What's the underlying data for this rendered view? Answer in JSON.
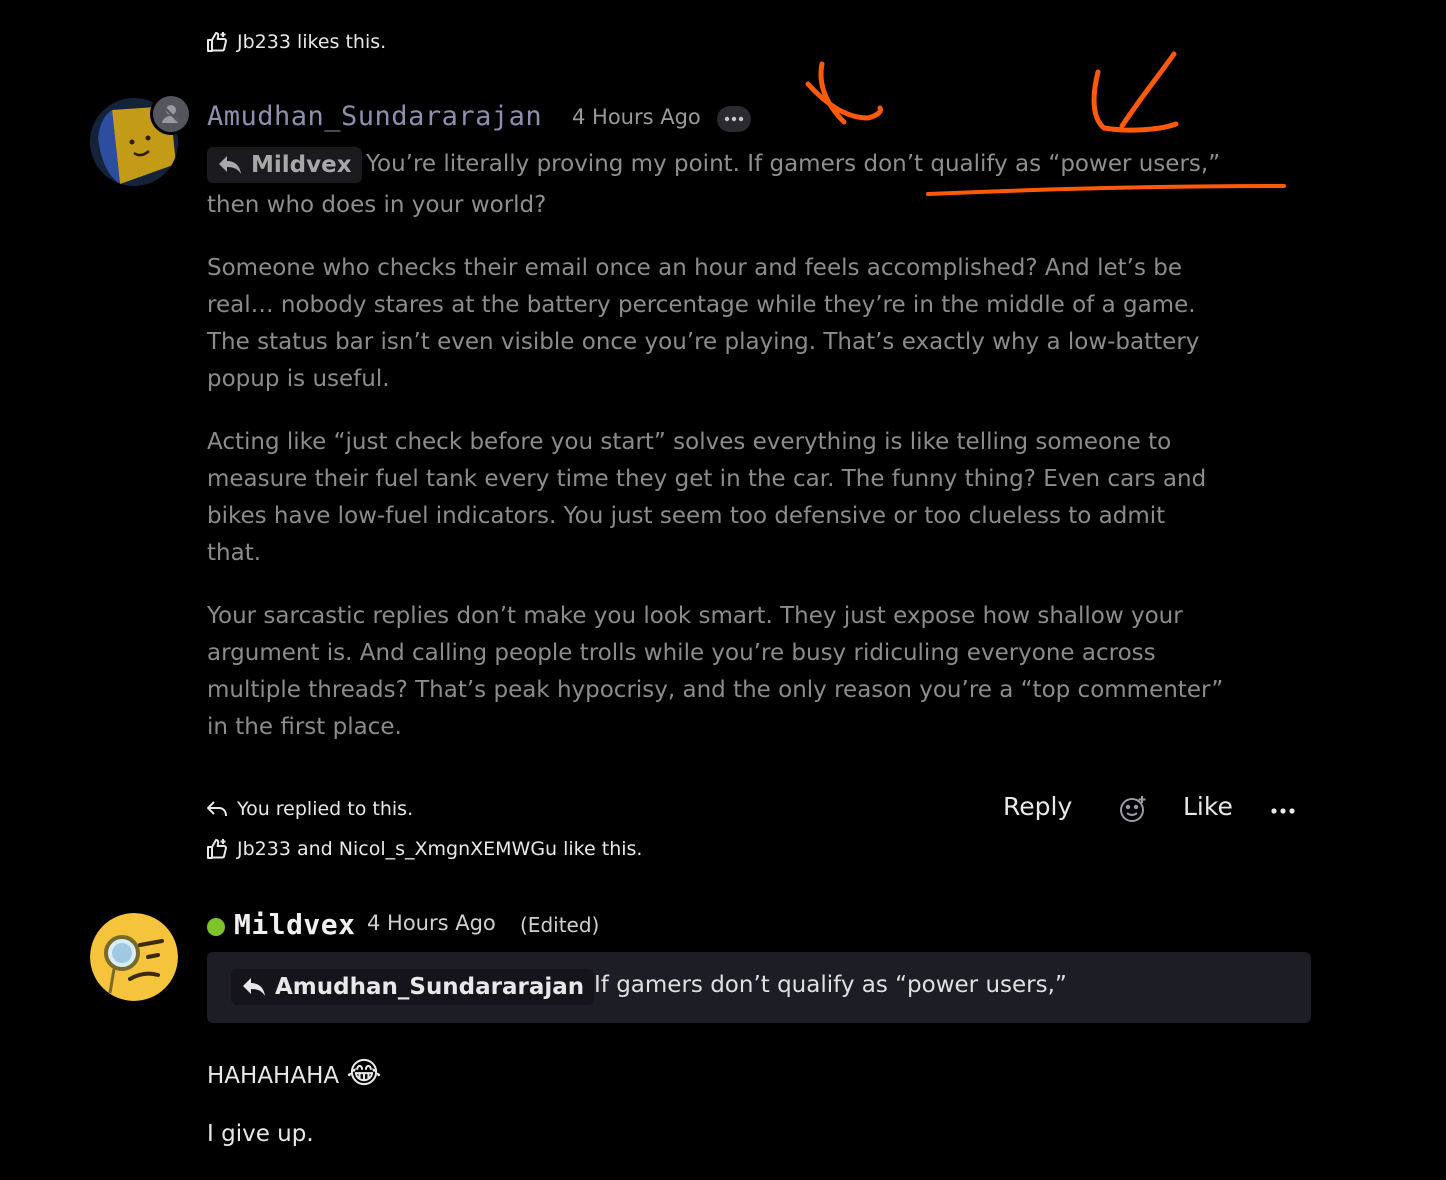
{
  "top_likes": {
    "text": "Jb233 likes this."
  },
  "comment1": {
    "username": "Amudhan_Sundararajan",
    "time": "4 Hours Ago",
    "quote_chip": "Mildvex",
    "first_line": "You’re literally proving my point. If gamers don’t qualify as “power users,”",
    "second_line": "then who does in your world?",
    "para2_l1": "Someone who checks their email once an hour and feels accomplished? And let’s be",
    "para2_l2": "real… nobody stares at the battery percentage while they’re in the middle of a game.",
    "para2_l3": "The status bar isn’t even visible once you’re playing. That’s exactly why a low-battery",
    "para2_l4": "popup is useful.",
    "para3_l1": "Acting like “just check before you start” solves everything is like telling someone to",
    "para3_l2": "measure their fuel tank every time they get in the car. The funny thing? Even cars and",
    "para3_l3": "bikes have low-fuel indicators. You just seem too defensive or too clueless to admit",
    "para3_l4": "that.",
    "para4_l1": "Your sarcastic replies don’t make you look smart. They just expose how shallow your",
    "para4_l2": "argument is. And calling people trolls while you’re busy ridiculing everyone across",
    "para4_l3": "multiple threads? That’s peak hypocrisy, and the only reason you’re a “top commenter”",
    "para4_l4": "in the first place.",
    "replied_text": "You replied to this.",
    "likes_text": "Jb233 and Nicol_s_XmgnXEMWGu like this.",
    "reply_label": "Reply",
    "like_label": "Like"
  },
  "comment2": {
    "username": "Mildvex",
    "time": "4 Hours Ago",
    "edited": "(Edited)",
    "quote_user": "Amudhan_Sundararajan",
    "quote_text": "If gamers don’t qualify as “power users,”",
    "line1": "HAHAHAHA",
    "line1_emoji": "😂",
    "line2": "I give up."
  },
  "colors": {
    "background": "#000000",
    "annotation": "#ff5a0a",
    "online": "#7cc42a"
  }
}
